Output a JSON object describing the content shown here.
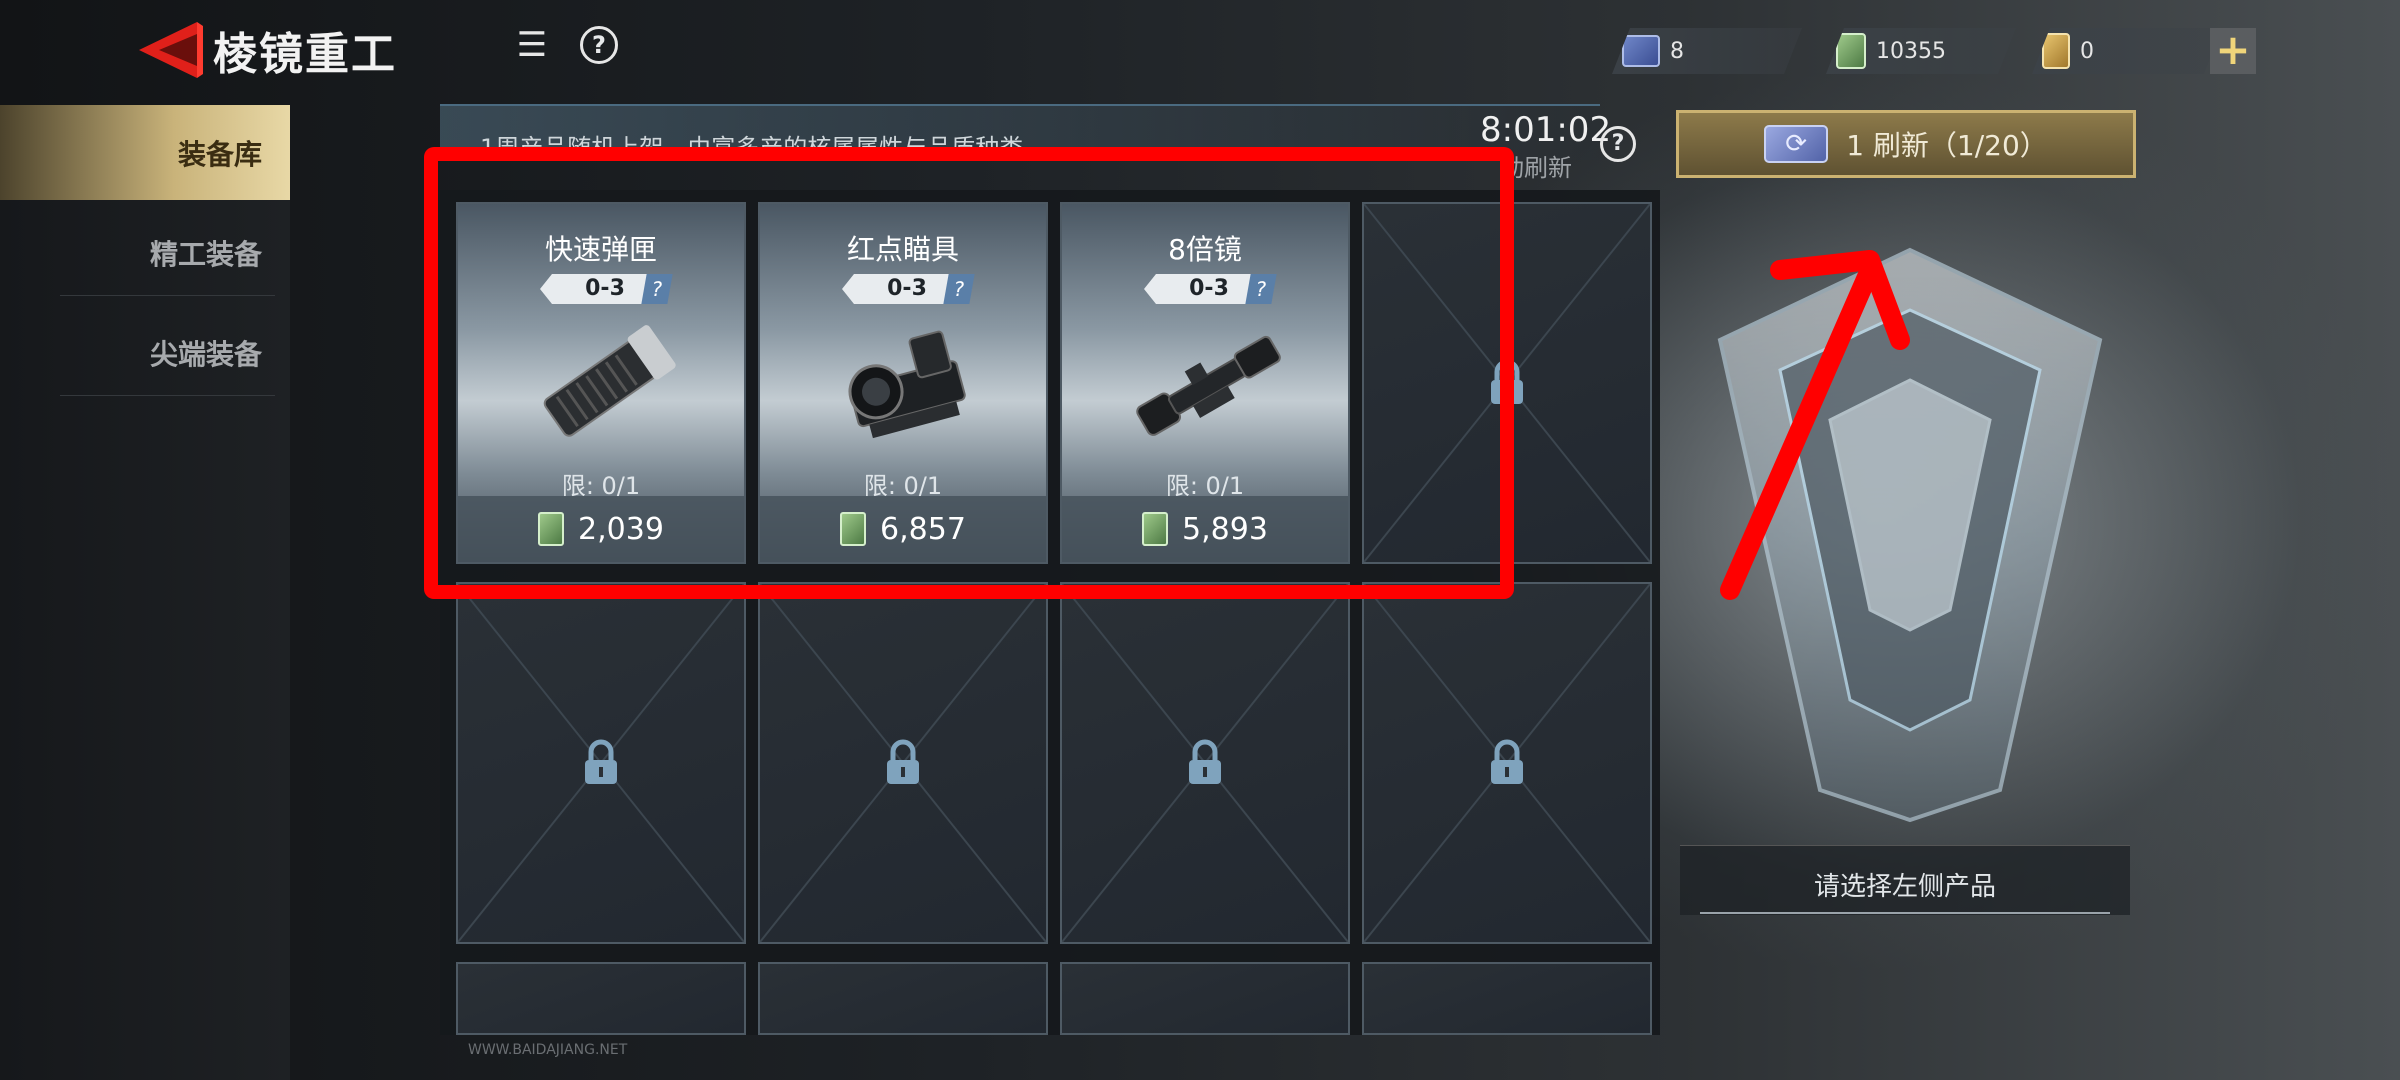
{
  "app": {
    "title": "棱镜重工"
  },
  "top_bar": {
    "menu_icon": "list-icon",
    "help_icon": "help-circle-icon",
    "currencies": [
      {
        "name": "ticket",
        "value": "8",
        "icon": "refresh-ticket-icon"
      },
      {
        "name": "cash",
        "value": "10355",
        "icon": "cash-icon"
      },
      {
        "name": "gold",
        "value": "0",
        "icon": "gold-voucher-icon"
      }
    ],
    "plus_label": "+"
  },
  "sidebar": {
    "items": [
      {
        "label": "装备库",
        "active": true
      },
      {
        "label": "精工装备",
        "active": false
      },
      {
        "label": "尖端装备",
        "active": false
      }
    ]
  },
  "banner": {
    "text": "1周产品随机上架，由富多产的核属属性与品质种类",
    "timer": "8:01:02",
    "timer_sub": "动刷新"
  },
  "refresh_button": {
    "label": "1 刷新（1/20）"
  },
  "shop": {
    "items": [
      {
        "name": "快速弹匣",
        "tier": "0-3",
        "tier_help": "?",
        "limit": "限: 0/1",
        "price": "2,039"
      },
      {
        "name": "红点瞄具",
        "tier": "0-3",
        "tier_help": "?",
        "limit": "限: 0/1",
        "price": "6,857"
      },
      {
        "name": "8倍镜",
        "tier": "0-3",
        "tier_help": "?",
        "limit": "限: 0/1",
        "price": "5,893"
      }
    ]
  },
  "detail_panel": {
    "prompt": "请选择左侧产品"
  },
  "watermark": "WWW.BAIDAJIANG.NET"
}
